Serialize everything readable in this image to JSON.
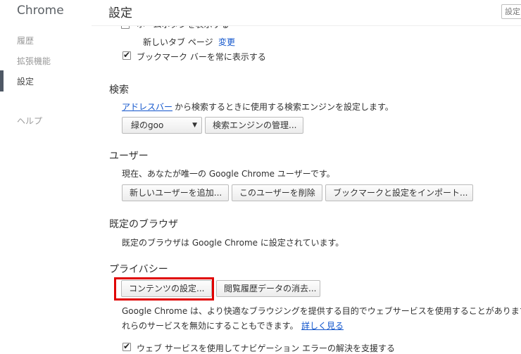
{
  "sidebar": {
    "brand": "Chrome",
    "items": [
      {
        "label": "履歴"
      },
      {
        "label": "拡張機能"
      },
      {
        "label": "設定"
      },
      {
        "label": "ヘルプ"
      }
    ]
  },
  "header": {
    "title": "設定",
    "search_placeholder": "設定"
  },
  "startup": {
    "home_button_label": "ホームボタンを表示する",
    "new_tab_label": "新しいタブ ページ",
    "change_link": "変更",
    "bookmarks_bar_label": "ブックマーク バーを常に表示する"
  },
  "search": {
    "title": "検索",
    "address_bar_link": "アドレスバー",
    "description": "から検索するときに使用する検索エンジンを設定します。",
    "engine_selected": "緑のgoo",
    "manage_button": "検索エンジンの管理..."
  },
  "users": {
    "title": "ユーザー",
    "description": "現在、あなたが唯一の Google Chrome ユーザーです。",
    "add_button": "新しいユーザーを追加...",
    "delete_button": "このユーザーを削除",
    "import_button": "ブックマークと設定をインポート..."
  },
  "default_browser": {
    "title": "既定のブラウザ",
    "description": "既定のブラウザは Google Chrome に設定されています。"
  },
  "privacy": {
    "title": "プライバシー",
    "content_settings_button": "コンテンツの設定...",
    "clear_data_button": "閲覧履歴データの消去...",
    "description_line1": "Google Chrome は、より快適なブラウジングを提供する目的でウェブサービスを使用することがあります",
    "description_line2": "れらのサービスを無効にすることもできます。",
    "learn_more_link": "詳しく見る",
    "nav_error_label": "ウェブ サービスを使用してナビゲーション エラーの解決を支援する"
  },
  "colors": {
    "link": "#1155cc",
    "highlight": "#e00000",
    "active_nav": "#4e5865"
  }
}
